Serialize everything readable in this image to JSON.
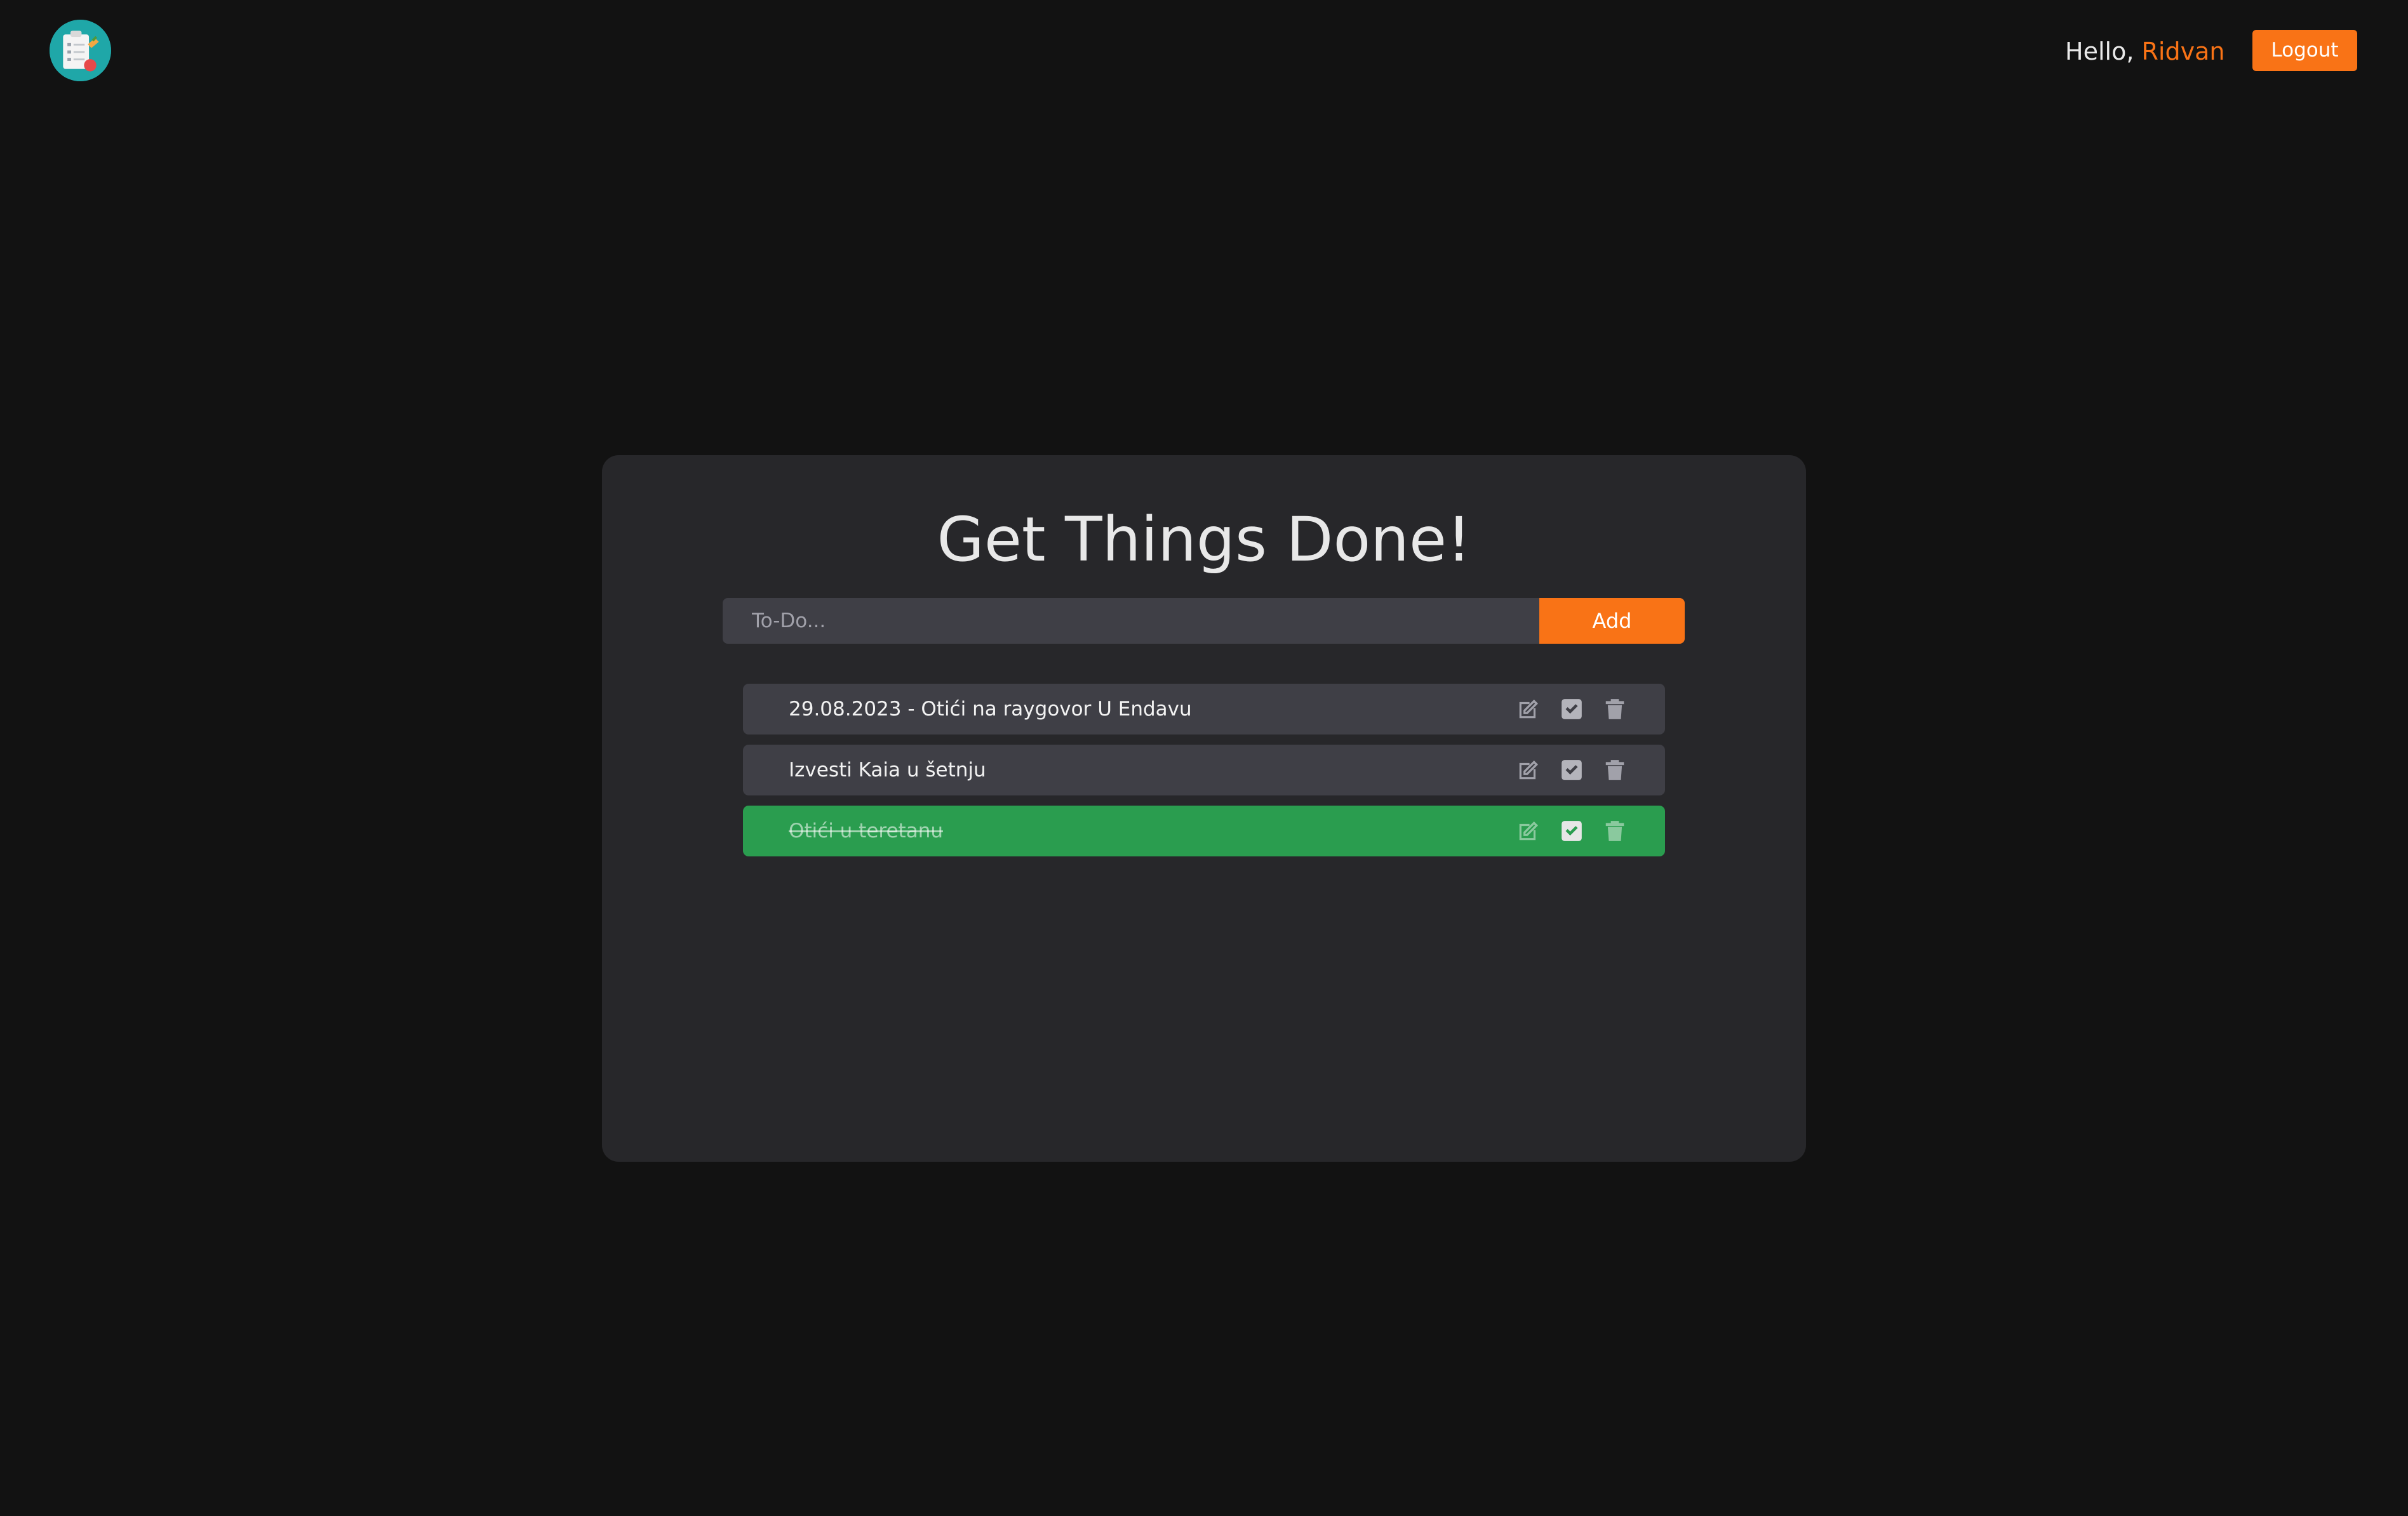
{
  "header": {
    "greeting_prefix": "Hello,",
    "username": "Ridvan",
    "logout_label": "Logout",
    "logo_icon": "clipboard-checklist-icon"
  },
  "main": {
    "title": "Get Things Done!",
    "input": {
      "placeholder": "To-Do...",
      "value": ""
    },
    "add_label": "Add",
    "todos": [
      {
        "text": "29.08.2023 - Otići na raygovor U Endavu",
        "completed": false
      },
      {
        "text": "Izvesti Kaia u šetnju",
        "completed": false
      },
      {
        "text": "Otići u teretanu",
        "completed": true
      }
    ],
    "item_actions": [
      "edit-icon",
      "check-icon",
      "trash-icon"
    ]
  },
  "colors": {
    "background": "#121212",
    "card": "#27272a",
    "accent": "#f97316",
    "item": "#3f3f46",
    "completed": "#2a9d4f"
  }
}
